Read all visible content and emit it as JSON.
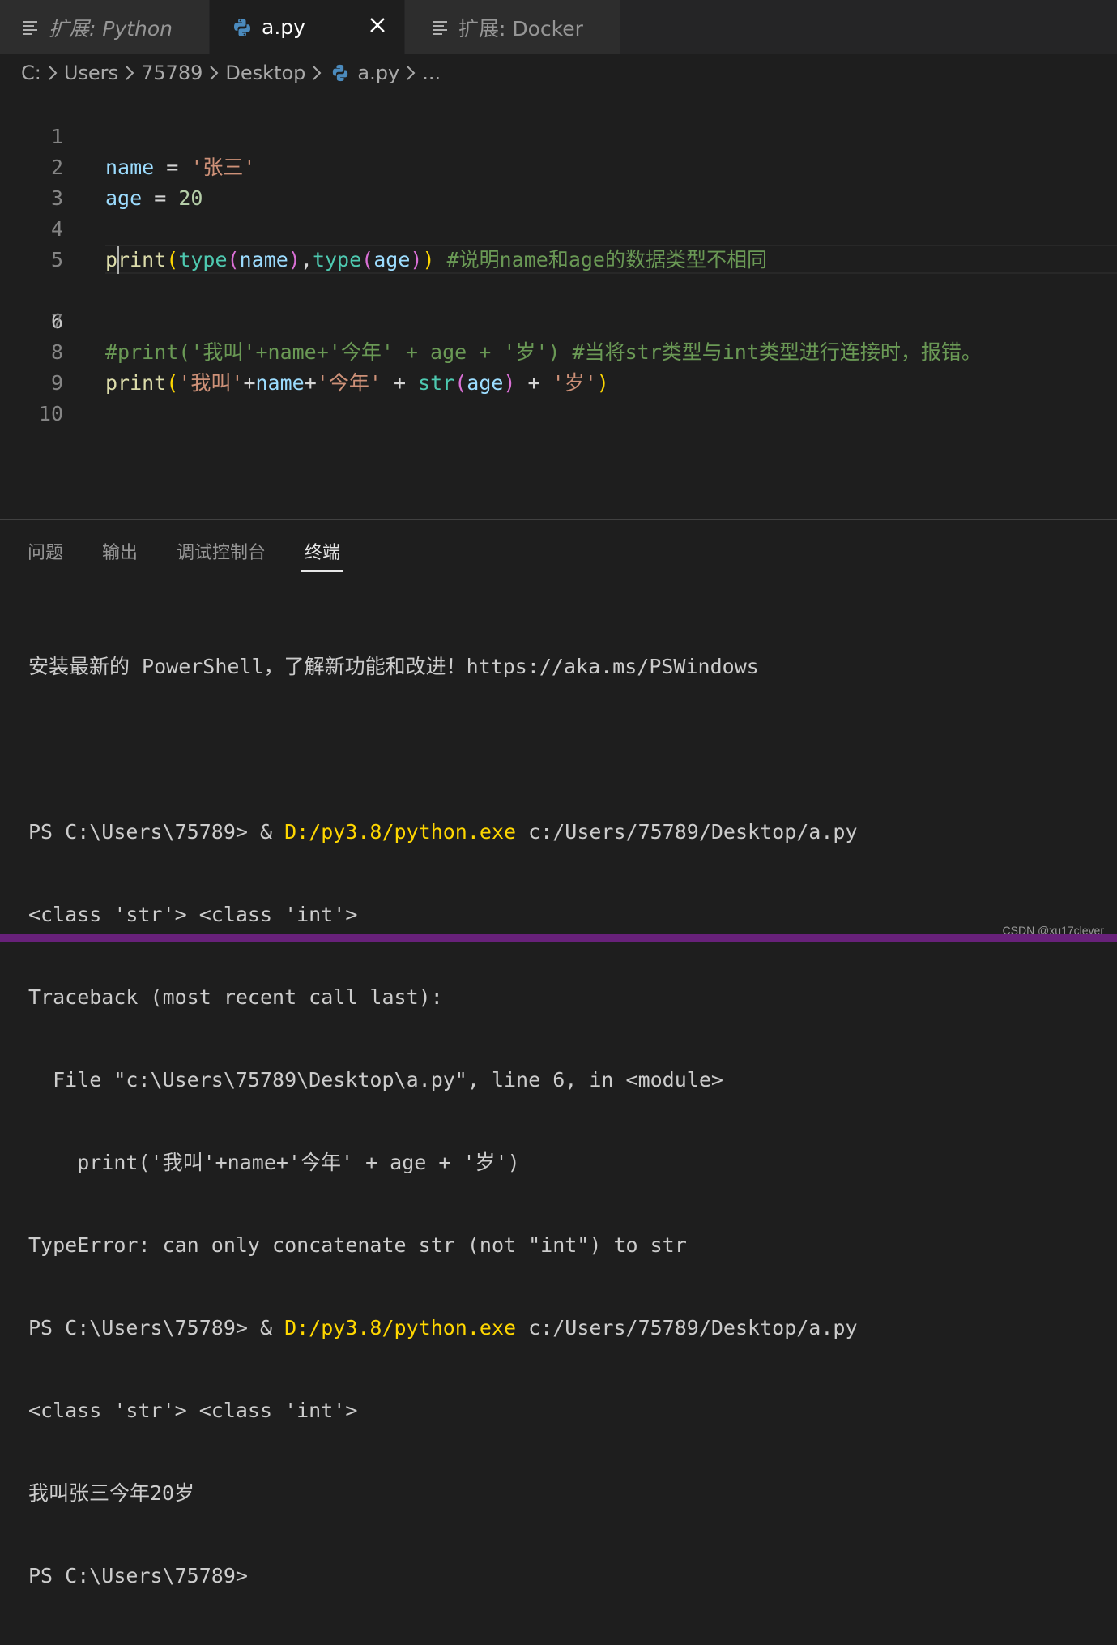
{
  "tabs": [
    {
      "label": "扩展: Python",
      "icon": "list-icon"
    },
    {
      "label": "a.py",
      "icon": "python-icon",
      "close": "×"
    },
    {
      "label": "扩展: Docker",
      "icon": "list-icon"
    }
  ],
  "breadcrumb": [
    "C:",
    "Users",
    "75789",
    "Desktop",
    "a.py",
    "..."
  ],
  "editor": {
    "line_numbers": [
      "1",
      "2",
      "3",
      "4",
      "5",
      "6",
      "7",
      "8",
      "9",
      "10"
    ],
    "active_line": 6,
    "lines": {
      "l1": {
        "var": "name",
        "op": " = ",
        "str": "'张三'"
      },
      "l2": {
        "var": "age",
        "op": " = ",
        "num": "20"
      },
      "l4": {
        "fn1": "print",
        "p1": "(",
        "bi1": "type",
        "p2": "(",
        "var1": "name",
        "p3": ")",
        "comma": ",",
        "bi2": "type",
        "p4": "(",
        "var2": "age",
        "p5": ")",
        "p6": ")",
        "cm": " #说明name和age的数据类型不相同"
      },
      "l6": {
        "cm": "#print('我叫'+name+'今年' + age + '岁') #当将str类型与int类型进行连接时，报错。"
      },
      "l8": {
        "fn": "print",
        "p1": "(",
        "s1": "'我叫'",
        "o1": "+",
        "v1": "name",
        "o2": "+",
        "s2": "'今年'",
        "o3": " + ",
        "bi": "str",
        "p2": "(",
        "v2": "age",
        "p3": ")",
        "o4": " + ",
        "s3": "'岁'",
        "p4": ")"
      }
    }
  },
  "panel": {
    "tabs": [
      "问题",
      "输出",
      "调试控制台",
      "终端"
    ],
    "active_tab": "终端"
  },
  "terminal": {
    "banner": "安装最新的 PowerShell，了解新功能和改进！https://aka.ms/PSWindows",
    "cmd1_prompt": "PS C:\\Users\\75789> & ",
    "cmd1_exe": "D:/py3.8/python.exe",
    "cmd1_arg": " c:/Users/75789/Desktop/a.py",
    "out1": "<class 'str'> <class 'int'>",
    "tb1": "Traceback (most recent call last):",
    "tb2": "  File \"c:\\Users\\75789\\Desktop\\a.py\", line 6, in <module>",
    "tb3": "    print('我叫'+name+'今年' + age + '岁')",
    "tb4": "TypeError: can only concatenate str (not \"int\") to str",
    "cmd2_prompt": "PS C:\\Users\\75789> & ",
    "cmd2_exe": "D:/py3.8/python.exe",
    "cmd2_arg": " c:/Users/75789/Desktop/a.py",
    "out2": "<class 'str'> <class 'int'>",
    "out3": "我叫张三今年20岁",
    "prompt_final": "PS C:\\Users\\75789>"
  },
  "watermark": "CSDN @xu17clever",
  "colors": {
    "accent_status": "#68217a",
    "active_tab_bg": "#1e1e1e",
    "inactive_tab_bg": "#2d2d2d"
  }
}
